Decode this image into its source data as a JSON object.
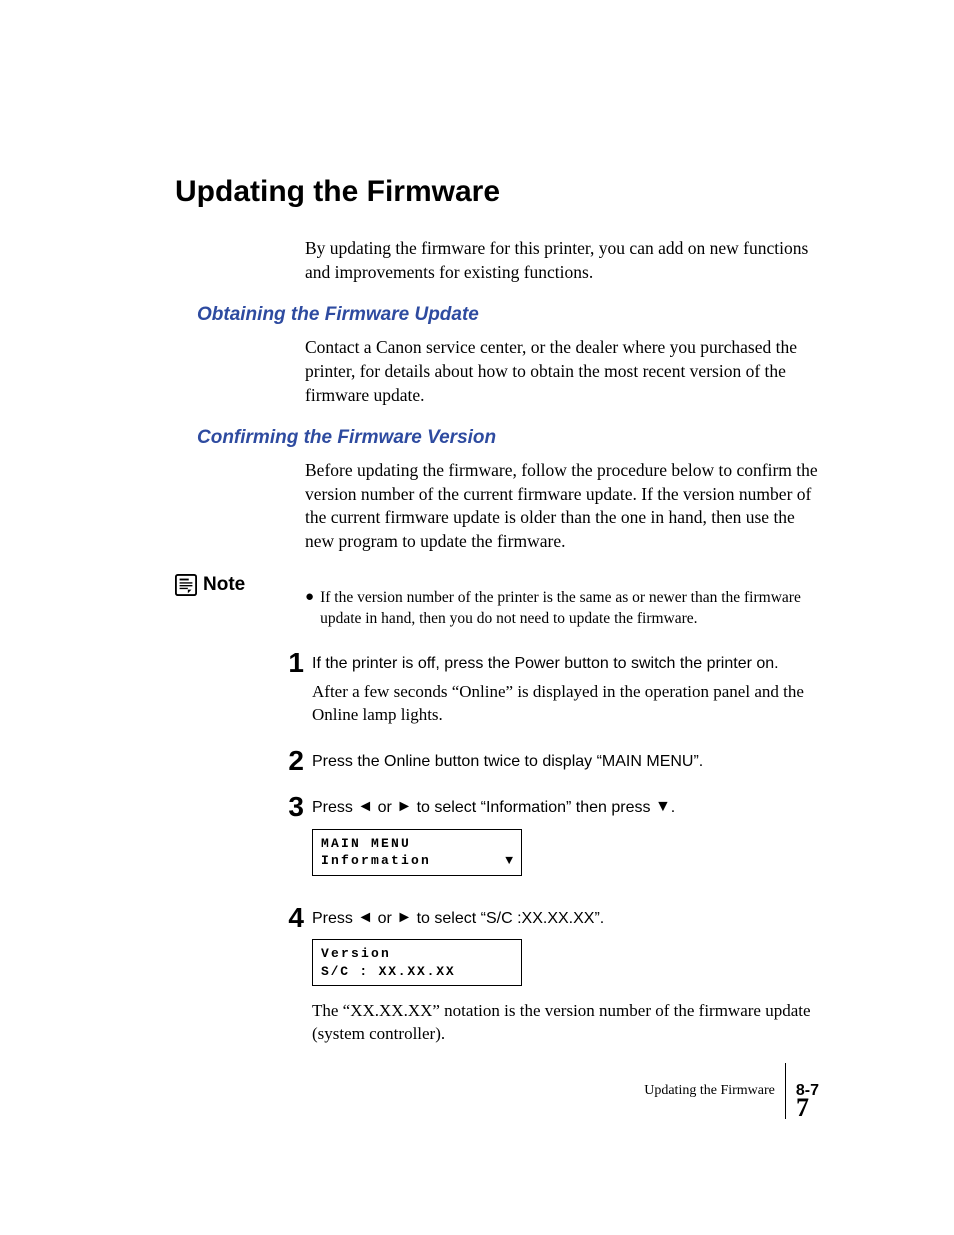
{
  "h1": "Updating the Firmware",
  "intro": "By updating the firmware for this printer, you can add on new functions and improvements for existing functions.",
  "sec1": {
    "title": "Obtaining the Firmware Update",
    "body": "Contact a Canon service center, or the dealer where you purchased the printer, for details about how to obtain the most recent version of the firmware update."
  },
  "sec2": {
    "title": "Confirming the Firmware Version",
    "body": "Before updating the firmware, follow the procedure below to confirm the version number of the current firmware update. If the version number of the current firmware update is older than the one in hand, then use the new program to update the firmware."
  },
  "note": {
    "label": "Note",
    "body": "If the version number of the printer is the same as or newer than the firmware update in hand, then you do not need to update the firmware."
  },
  "steps": {
    "s1": {
      "num": "1",
      "lead": "If the printer is off, press the Power button to switch the printer on.",
      "follow": "After a few seconds “Online” is displayed in the operation panel and the Online lamp lights."
    },
    "s2": {
      "num": "2",
      "lead": "Press the Online button twice to display “MAIN MENU”."
    },
    "s3": {
      "num": "3",
      "lead_pre": "Press ",
      "lead_mid": " or ",
      "lead_post": " to select “Information” then press ",
      "lead_end": ".",
      "lcd_line1": "MAIN MENU",
      "lcd_line2": "Information",
      "lcd_arrow": "▼"
    },
    "s4": {
      "num": "4",
      "lead_pre": "Press ",
      "lead_mid": " or ",
      "lead_post": " to select “S/C  :XX.XX.XX”.",
      "lcd_line1": "Version",
      "lcd_line2": "S/C   : XX.XX.XX",
      "follow": "The “XX.XX.XX” notation is the version number of the firmware update (system controller)."
    }
  },
  "glyphs": {
    "left": "◄",
    "right": "►",
    "down": "▼",
    "bullet": "●"
  },
  "footer": {
    "title": "Updating the Firmware",
    "pagelabel": "8-7",
    "pagenum": "7"
  }
}
